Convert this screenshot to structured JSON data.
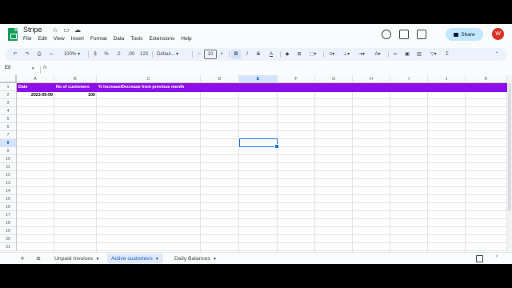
{
  "app": {
    "title": "Stripe",
    "menus": [
      "File",
      "Edit",
      "View",
      "Insert",
      "Format",
      "Data",
      "Tools",
      "Extensions",
      "Help"
    ],
    "share_label": "Share",
    "avatar_initial": "W"
  },
  "toolbar": {
    "zoom": "100%",
    "currency": "$",
    "percent": "%",
    "decrease_decimal": ".0",
    "increase_decimal": ".00",
    "number_format": "123",
    "font": "Defaul...",
    "font_size": "10",
    "font_size_minus": "−",
    "font_size_plus": "+",
    "bold": "B",
    "italic": "I",
    "strikethrough": "S",
    "text_color": "A",
    "function": "Σ"
  },
  "formula_bar": {
    "name_box": "E8",
    "fx": "fx",
    "value": ""
  },
  "sheet": {
    "columns": [
      "A",
      "B",
      "C",
      "D",
      "E",
      "F",
      "G",
      "H",
      "I",
      "J",
      "K"
    ],
    "active_column": "E",
    "active_row": 8,
    "rows": [
      "1",
      "2",
      "3",
      "4",
      "5",
      "6",
      "7",
      "8",
      "9",
      "10",
      "11",
      "12",
      "13",
      "14",
      "15",
      "16",
      "17",
      "18",
      "19",
      "20",
      "21"
    ],
    "header_row": {
      "a": "Date",
      "b": "No of customers",
      "c": "% Increase/Decrease from previous month"
    },
    "data_row": {
      "a": "2023-05-09",
      "b": "100"
    },
    "header_fill": "#8d0ee8"
  },
  "tabs": [
    {
      "label": "Unpaid Invoices",
      "active": false
    },
    {
      "label": "Active customers",
      "active": true
    },
    {
      "label": "Daily Balances",
      "active": false
    }
  ],
  "tab_controls": {
    "add": "+",
    "all_sheets": "≡"
  }
}
